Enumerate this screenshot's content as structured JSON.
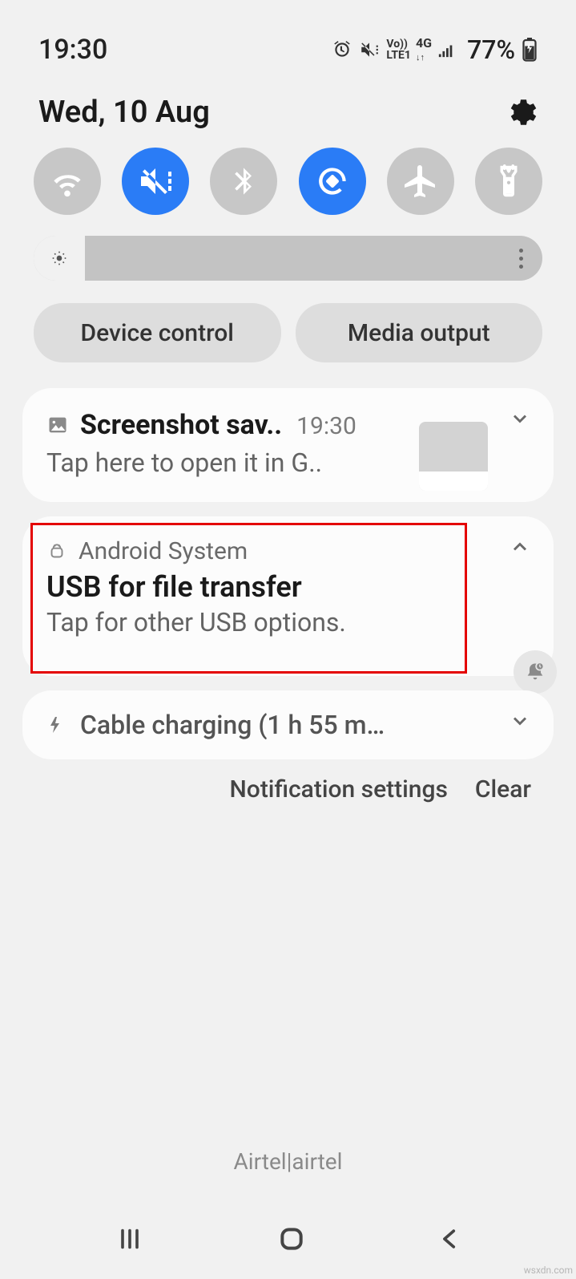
{
  "status": {
    "time": "19:30",
    "battery": "77%",
    "icons": [
      "alarm",
      "mute-vibrate",
      "volte1",
      "4g-arrows",
      "signal",
      "battery-charging"
    ]
  },
  "date_row": {
    "date": "Wed, 10 Aug"
  },
  "toggles": [
    {
      "name": "wifi",
      "active": false
    },
    {
      "name": "mute",
      "active": true
    },
    {
      "name": "bluetooth",
      "active": false
    },
    {
      "name": "auto-rotate",
      "active": true
    },
    {
      "name": "airplane",
      "active": false
    },
    {
      "name": "flashlight",
      "active": false
    }
  ],
  "pills": {
    "device_control": "Device control",
    "media_output": "Media output"
  },
  "notifications": [
    {
      "app_icon": "image",
      "title": "Screenshot sav..",
      "time": "19:30",
      "subtitle": "Tap here to open it in G..",
      "has_thumb": true,
      "collapsed": true
    },
    {
      "app_icon": "android",
      "app_name": "Android System",
      "title": "USB for file transfer",
      "subtitle": "Tap for other USB options.",
      "highlighted": true,
      "collapsed": false
    },
    {
      "app_icon": "bolt",
      "title": "Cable charging (1 h 55 m…",
      "compact": true,
      "collapsed": true
    }
  ],
  "bottom": {
    "settings_label": "Notification settings",
    "clear_label": "Clear"
  },
  "carrier": "Airtel|airtel",
  "watermark": "wsxdn.com"
}
